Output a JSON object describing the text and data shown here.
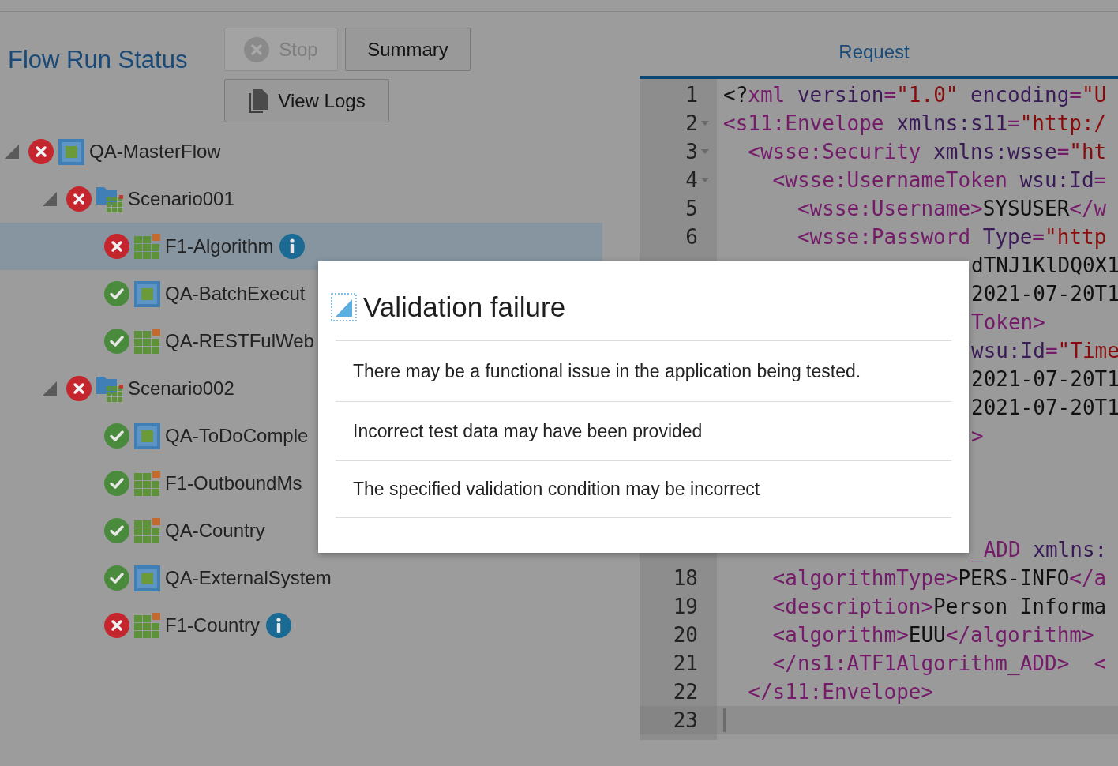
{
  "header": {
    "title": "Flow Run Status"
  },
  "buttons": [
    {
      "kind": "stop",
      "label": "Stop",
      "disabled": true
    },
    {
      "kind": "plain",
      "label": "Summary",
      "disabled": false
    },
    {
      "kind": "logs",
      "label": "View Logs",
      "disabled": false
    }
  ],
  "tree": [
    {
      "label": "QA-MasterFlow",
      "kind": "flow",
      "failed": true,
      "expanded": true,
      "selected": false,
      "info": false,
      "children": [
        {
          "label": "Scenario001",
          "kind": "scenario",
          "failed": true,
          "expanded": true,
          "selected": false,
          "info": false,
          "children": [
            {
              "label": "F1-Algorithm",
              "kind": "component",
              "failed": true,
              "selected": true,
              "info": true
            },
            {
              "label": "QA-BatchExecut",
              "kind": "flow",
              "failed": false,
              "selected": false,
              "info": false
            },
            {
              "label": "QA-RESTFulWeb",
              "kind": "component",
              "failed": false,
              "selected": false,
              "info": false
            }
          ]
        },
        {
          "label": "Scenario002",
          "kind": "scenario",
          "failed": true,
          "expanded": true,
          "selected": false,
          "info": false,
          "children": [
            {
              "label": "QA-ToDoComple",
              "kind": "flow",
              "failed": false,
              "selected": false,
              "info": false
            },
            {
              "label": "F1-OutboundMs",
              "kind": "component",
              "failed": false,
              "selected": false,
              "info": false
            },
            {
              "label": "QA-Country",
              "kind": "component",
              "failed": false,
              "selected": false,
              "info": false
            },
            {
              "label": "QA-ExternalSystem",
              "kind": "flow",
              "failed": false,
              "selected": false,
              "info": false
            },
            {
              "label": "F1-Country",
              "kind": "component",
              "failed": true,
              "selected": false,
              "info": true
            }
          ]
        }
      ]
    }
  ],
  "request": {
    "title": "Request",
    "lines": [
      {
        "kind": "full",
        "number": "1",
        "foldable": false,
        "current": false,
        "segments": [
          {
            "kind": "text",
            "text": "<?"
          },
          {
            "kind": "tag",
            "text": "xml"
          },
          {
            "kind": "attr",
            "text": " version"
          },
          {
            "kind": "tag",
            "text": "="
          },
          {
            "kind": "value",
            "text": "\"1.0\""
          },
          {
            "kind": "attr",
            "text": " encoding"
          },
          {
            "kind": "tag",
            "text": "="
          },
          {
            "kind": "value",
            "text": "\"U"
          }
        ]
      },
      {
        "kind": "full",
        "number": "2",
        "foldable": true,
        "current": false,
        "segments": [
          {
            "kind": "tag",
            "text": "<s11:Envelope"
          },
          {
            "kind": "attr",
            "text": " xmlns:s11"
          },
          {
            "kind": "tag",
            "text": "="
          },
          {
            "kind": "value",
            "text": "\"http:/"
          }
        ]
      },
      {
        "kind": "full",
        "number": "3",
        "foldable": true,
        "current": false,
        "segments": [
          {
            "kind": "tag",
            "text": "  <wsse:Security"
          },
          {
            "kind": "attr",
            "text": " xmlns:wsse"
          },
          {
            "kind": "tag",
            "text": "="
          },
          {
            "kind": "value",
            "text": "\"ht"
          }
        ]
      },
      {
        "kind": "full",
        "number": "4",
        "foldable": true,
        "current": false,
        "segments": [
          {
            "kind": "tag",
            "text": "    <wsse:UsernameToken"
          },
          {
            "kind": "attr",
            "text": " wsu:Id"
          },
          {
            "kind": "tag",
            "text": "="
          }
        ]
      },
      {
        "kind": "full",
        "number": "5",
        "foldable": false,
        "current": false,
        "segments": [
          {
            "kind": "tag",
            "text": "      <wsse:Username>"
          },
          {
            "kind": "text",
            "text": "SYSUSER"
          },
          {
            "kind": "tag",
            "text": "</w"
          }
        ]
      },
      {
        "kind": "full",
        "number": "6",
        "foldable": false,
        "current": false,
        "segments": [
          {
            "kind": "tag",
            "text": "      <wsse:Password"
          },
          {
            "kind": "attr",
            "text": " Type"
          },
          {
            "kind": "tag",
            "text": "="
          },
          {
            "kind": "value",
            "text": "\"http"
          }
        ]
      },
      {
        "kind": "partial",
        "segments": [
          {
            "kind": "text",
            "text": "dTNJ1KlDQ0X1"
          }
        ]
      },
      {
        "kind": "partial",
        "segments": [
          {
            "kind": "text",
            "text": "2021-07-20T1"
          }
        ]
      },
      {
        "kind": "partial",
        "segments": [
          {
            "kind": "tag",
            "text": "Token>"
          }
        ]
      },
      {
        "kind": "partial",
        "segments": [
          {
            "kind": "attr",
            "text": "wsu:Id"
          },
          {
            "kind": "tag",
            "text": "="
          },
          {
            "kind": "value",
            "text": "\"Time"
          }
        ]
      },
      {
        "kind": "partial",
        "segments": [
          {
            "kind": "text",
            "text": "2021-07-20T1"
          }
        ]
      },
      {
        "kind": "partial",
        "segments": [
          {
            "kind": "text",
            "text": "2021-07-20T1"
          }
        ]
      },
      {
        "kind": "partial",
        "segments": [
          {
            "kind": "tag",
            "text": ">"
          }
        ]
      },
      {
        "kind": "partial"
      },
      {
        "kind": "partial"
      },
      {
        "kind": "partial"
      },
      {
        "kind": "partial",
        "segments": [
          {
            "kind": "tag",
            "text": "_ADD"
          },
          {
            "kind": "attr",
            "text": " xmlns:"
          }
        ]
      },
      {
        "kind": "full",
        "number": "18",
        "foldable": false,
        "current": false,
        "segments": [
          {
            "kind": "tag",
            "text": "    <algorithmType>"
          },
          {
            "kind": "text",
            "text": "PERS-INFO"
          },
          {
            "kind": "tag",
            "text": "</a"
          }
        ]
      },
      {
        "kind": "full",
        "number": "19",
        "foldable": false,
        "current": false,
        "segments": [
          {
            "kind": "tag",
            "text": "    <description>"
          },
          {
            "kind": "text",
            "text": "Person Informa"
          }
        ]
      },
      {
        "kind": "full",
        "number": "20",
        "foldable": false,
        "current": false,
        "segments": [
          {
            "kind": "tag",
            "text": "    <algorithm>"
          },
          {
            "kind": "text",
            "text": "EUU"
          },
          {
            "kind": "tag",
            "text": "</algorithm>"
          }
        ]
      },
      {
        "kind": "full",
        "number": "21",
        "foldable": false,
        "current": false,
        "segments": [
          {
            "kind": "tag",
            "text": "    </ns1:ATF1Algorithm_ADD>  <"
          }
        ]
      },
      {
        "kind": "full",
        "number": "22",
        "foldable": false,
        "current": false,
        "segments": [
          {
            "kind": "tag",
            "text": "  </s11:Envelope>"
          }
        ]
      },
      {
        "kind": "full",
        "number": "23",
        "foldable": false,
        "current": true
      }
    ]
  },
  "dialog": {
    "title": "Validation failure",
    "items": [
      "There may be a functional issue in the application being tested.",
      "Incorrect test data may have been provided",
      "The specified validation condition may be incorrect"
    ]
  }
}
